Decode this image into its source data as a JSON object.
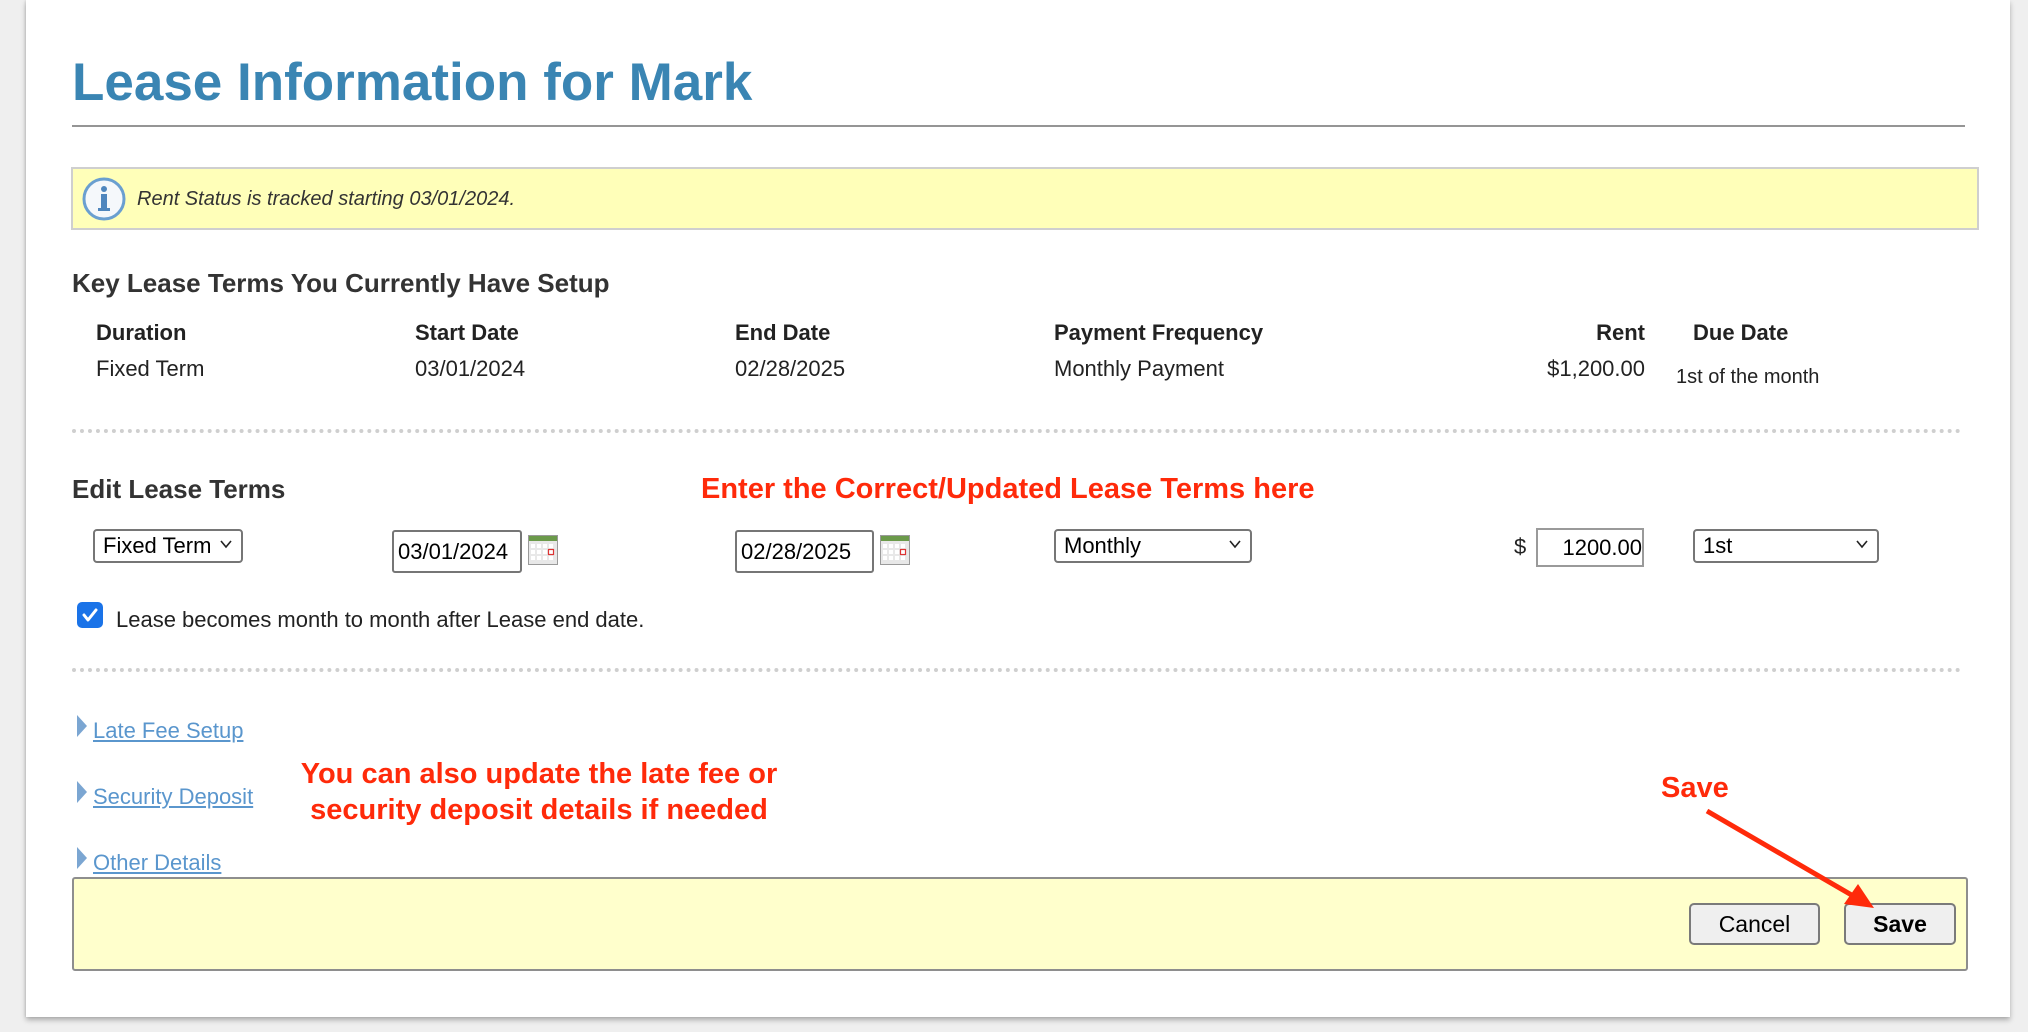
{
  "page": {
    "title": "Lease Information for Mark"
  },
  "info_bar": {
    "icon": "info-icon",
    "message": "Rent Status is tracked starting 03/01/2024."
  },
  "current_terms": {
    "heading": "Key Lease Terms You Currently Have Setup",
    "columns": [
      {
        "header": "Duration",
        "value": "Fixed Term"
      },
      {
        "header": "Start Date",
        "value": "03/01/2024"
      },
      {
        "header": "End Date",
        "value": "02/28/2025"
      },
      {
        "header": "Payment Frequency",
        "value": "Monthly Payment"
      },
      {
        "header": "Rent",
        "value": "$1,200.00"
      },
      {
        "header": "Due Date",
        "value": "1st of the month"
      }
    ]
  },
  "edit_terms": {
    "heading": "Edit Lease Terms",
    "duration_select": "Fixed Term",
    "start_date": "03/01/2024",
    "end_date": "02/28/2025",
    "frequency_select": "Monthly",
    "currency_symbol": "$",
    "rent_amount": "1200.00",
    "due_date_select": "1st",
    "month_to_month_checked": true,
    "month_to_month_label": "Lease becomes month to month after Lease end date."
  },
  "sections": [
    {
      "label": "Late Fee Setup"
    },
    {
      "label": "Security Deposit"
    },
    {
      "label": "Other Details"
    }
  ],
  "footer": {
    "cancel_label": "Cancel",
    "save_label": "Save"
  },
  "annotations": {
    "edit_hint": "Enter the Correct/Updated Lease Terms here",
    "sections_hint_line1": "You can also update the late fee or",
    "sections_hint_line2": "security deposit details if needed",
    "save_hint": "Save",
    "color": "#ff2a0a"
  },
  "colors": {
    "title": "#3a85b3",
    "info_bg": "#ffffb9",
    "footer_bg": "#ffffcc",
    "link": "#5a96cd",
    "checkbox": "#1a73e8"
  }
}
